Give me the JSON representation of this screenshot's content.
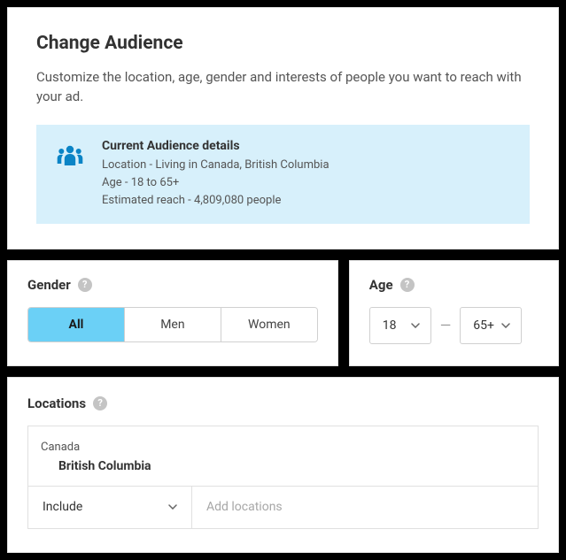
{
  "header": {
    "title": "Change Audience",
    "subtitle": "Customize the location, age, gender and interests of people you want to reach with your ad."
  },
  "audience": {
    "heading": "Current Audience details",
    "location": "Location - Living in Canada, British Columbia",
    "age": "Age - 18 to 65+",
    "reach": "Estimated reach - 4,809,080 people"
  },
  "gender": {
    "label": "Gender",
    "options": {
      "all": "All",
      "men": "Men",
      "women": "Women"
    },
    "selected": "all"
  },
  "age": {
    "label": "Age",
    "min": "18",
    "max": "65+"
  },
  "locations": {
    "label": "Locations",
    "country": "Canada",
    "region": "British Columbia",
    "mode": "Include",
    "placeholder": "Add locations"
  }
}
